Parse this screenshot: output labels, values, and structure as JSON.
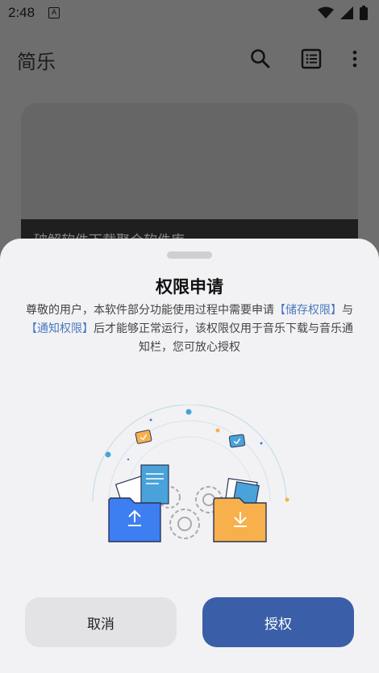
{
  "status_bar": {
    "time": "2:48",
    "notif_letter": "A"
  },
  "app_bar": {
    "title": "简乐"
  },
  "background_card": {
    "text": "破解软件下载聚合软件库"
  },
  "dialog": {
    "title": "权限申请",
    "message_part1": "尊敬的用户，本软件部分功能使用过程中需要申请",
    "link_storage": "【储存权限】",
    "message_part2": "与",
    "link_notify": "【通知权限】",
    "message_part3": "后才能够正常运行，该权限仅用于音乐下载与音乐通知栏，您可放心授权",
    "cancel_label": "取消",
    "grant_label": "授权"
  },
  "colors": {
    "accent": "#3a5fa8",
    "link": "#4a79c0",
    "folder_blue": "#3d7ef0",
    "folder_orange": "#f7b04b"
  }
}
